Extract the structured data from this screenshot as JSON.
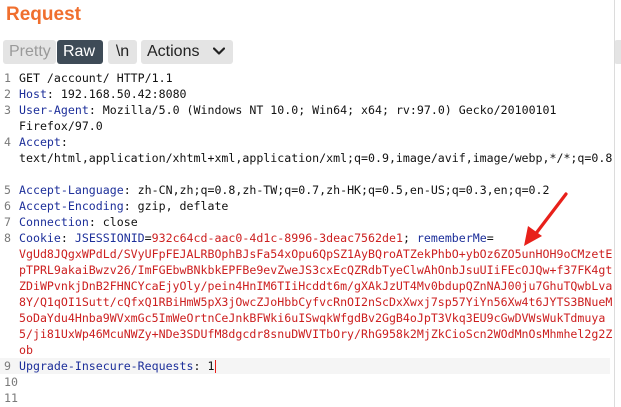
{
  "panel": {
    "title": "Request"
  },
  "toolbar": {
    "pretty_label": "Pretty",
    "raw_label": "Raw",
    "newline_label": "\\n",
    "actions_label": "Actions"
  },
  "editor": {
    "lines": [
      {
        "num": "1",
        "text": "GET /account/ HTTP/1.1"
      },
      {
        "num": "2",
        "key": "Host",
        "sep": ": ",
        "value": "192.168.50.42:8080"
      },
      {
        "num": "3",
        "key": "User-Agent",
        "sep": ": ",
        "value": "Mozilla/5.0 (Windows NT 10.0; Win64; x64; rv:97.0) Gecko/20100101 Firefox/97.0"
      },
      {
        "num": "4",
        "key": "Accept",
        "sep": ":",
        "value": "text/html,application/xhtml+xml,application/xml;q=0.9,image/avif,image/webp,*/*;q=0.8"
      },
      {
        "num": "5",
        "key": "Accept-Language",
        "sep": ": ",
        "value": "zh-CN,zh;q=0.8,zh-TW;q=0.7,zh-HK;q=0.5,en-US;q=0.3,en;q=0.2"
      },
      {
        "num": "6",
        "key": "Accept-Encoding",
        "sep": ": ",
        "value": "gzip, deflate"
      },
      {
        "num": "7",
        "key": "Connection",
        "sep": ": ",
        "value": "close"
      },
      {
        "num": "8",
        "key": "Cookie",
        "sep": ": ",
        "cookie1_name": "JSESSIONID",
        "cookie1_value": "932c64cd-aac0-4d1c-8996-3deac7562de1",
        "cookie_sep": "; ",
        "cookie2_name": "rememberMe",
        "cookie2_value": "VgUd8JQgxWPdLd/SVyUFpFEJALRBOphBJsFa54xOpu6QpSZ1AyBQroATZekPhbO+ybOz6ZO5unHOH9oCMzetEpTPRL9akaiBwzv26/ImFGEbwBNkbkEPFBe9evZweJS3cxEcQZRdbTyeClwAhOnbJsuUIiFEcOJQw+f37FK4gtZDiWPvnkjDnB2FHNCYcaEjyOly/pein4HnIM6TIiHcddt6m/gXAkJzUT4Mv0bdupQZnNAJ00ju7GhuTQwbLva8Y/Q1qOI1Sutt/cQfxQ1RBiHmW5pX3jOwcZJoHbbCyfvcRnOI2nScDxXwxj7sp57YiYn56Xw4t6JYTS3BNueM5oDaYdu4Hnba9WVxmGc5ImWeOrtnCeJnkBFWki6uISwqkWfgdBv2GgB4oJpT3Vkq3EU9cGwDVWsWukTdmuya5/ji81UxWp46McuNWZy+NDe3SDUfM8dgcdr8snuDWVITbOry/RhG958k2MjZkCioScn2WOdMnOsMhmhel2g2Zob"
      },
      {
        "num": "9",
        "key": "Upgrade-Insecure-Requests",
        "sep": ": ",
        "value": "1"
      },
      {
        "num": "10",
        "text": ""
      },
      {
        "num": "11",
        "text": ""
      }
    ]
  },
  "annotation": {
    "color": "#e8201a"
  }
}
